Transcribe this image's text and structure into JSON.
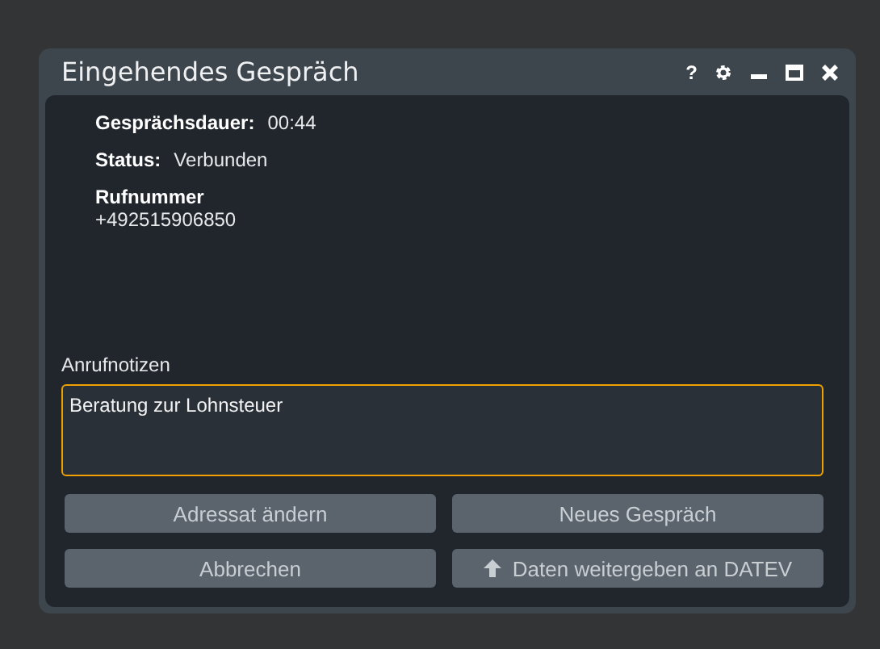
{
  "window": {
    "title": "Eingehendes Gespräch",
    "help": "?"
  },
  "fields": [
    {
      "kind": "inline",
      "label": "Gesprächsdauer:",
      "value": "00:44"
    },
    {
      "kind": "inline",
      "label": "Status:",
      "value": "Verbunden"
    },
    {
      "kind": "stacked",
      "label": "Rufnummer",
      "value": "+492515906850"
    }
  ],
  "notes": {
    "label": "Anrufnotizen",
    "value": "Beratung zur Lohnsteuer",
    "focused": true
  },
  "buttons": [
    {
      "kind": "plain",
      "label": "Adressat ändern"
    },
    {
      "kind": "plain",
      "label": "Neues Gespräch"
    },
    {
      "kind": "plain",
      "label": "Abbrechen"
    },
    {
      "kind": "upload",
      "label": "Daten weitergeben an DATEV"
    }
  ]
}
